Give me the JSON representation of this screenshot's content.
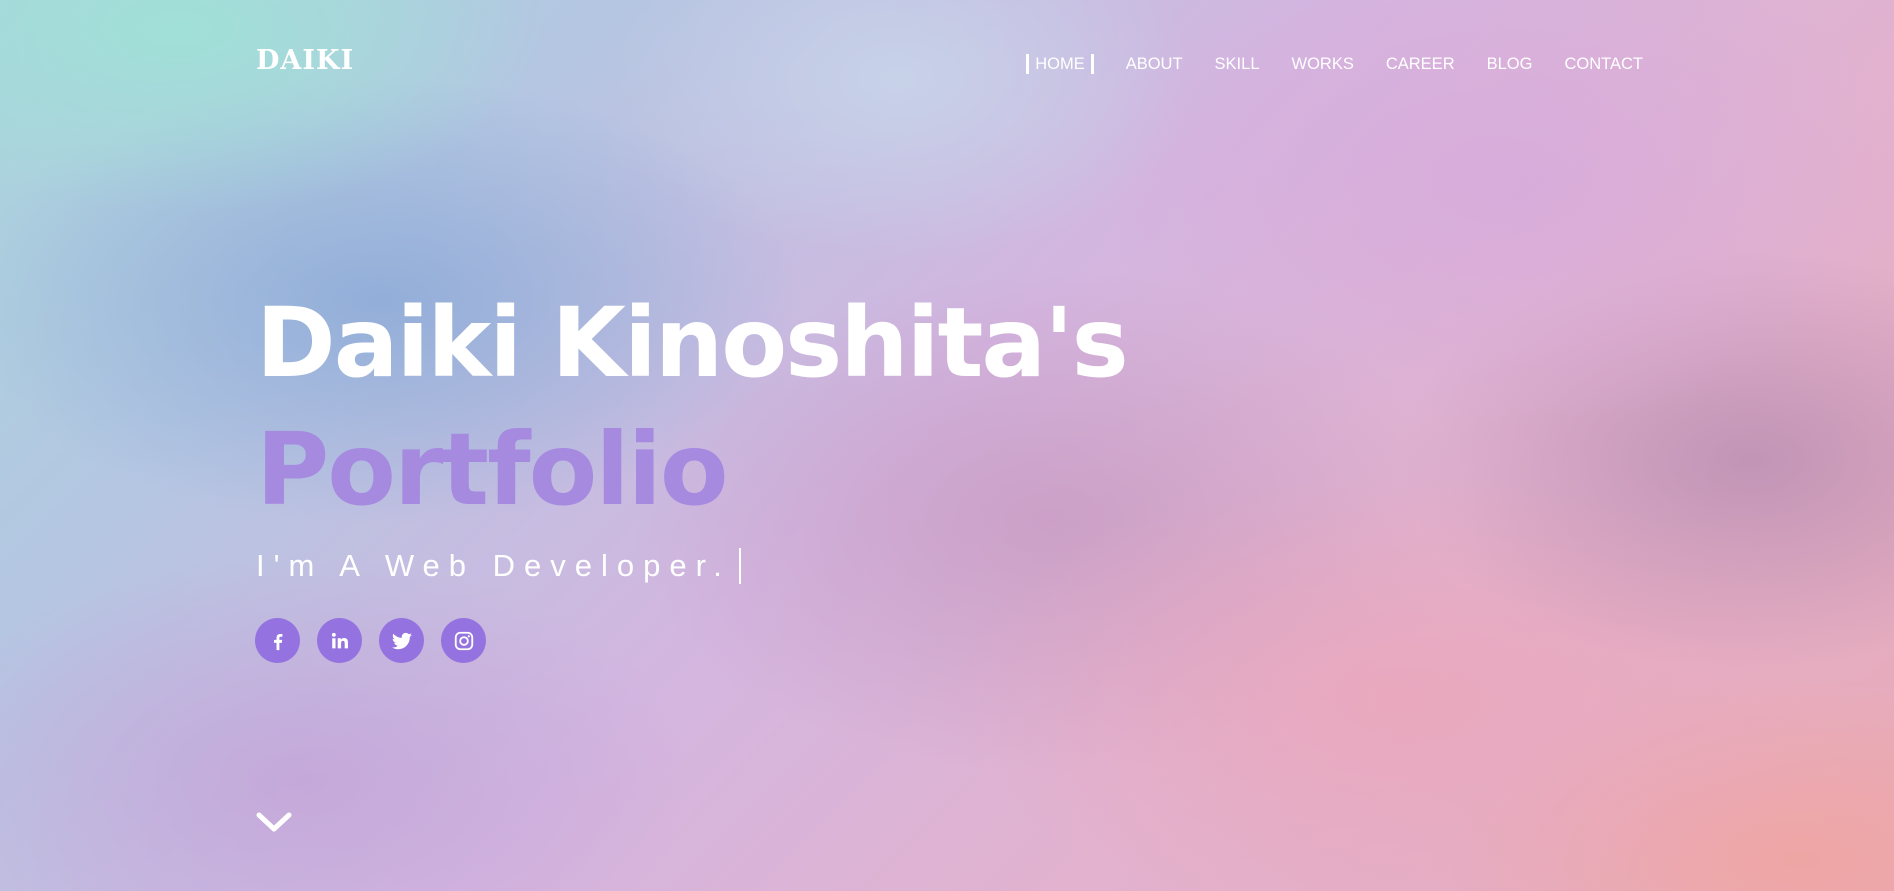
{
  "header": {
    "logo": "DAIKI",
    "nav": [
      {
        "label": "HOME",
        "active": true
      },
      {
        "label": "ABOUT",
        "active": false
      },
      {
        "label": "SKILL",
        "active": false
      },
      {
        "label": "WORKS",
        "active": false
      },
      {
        "label": "CAREER",
        "active": false
      },
      {
        "label": "BLOG",
        "active": false
      },
      {
        "label": "CONTACT",
        "active": false
      }
    ]
  },
  "hero": {
    "title_line1": "Daiki Kinoshita's",
    "title_line2": "Portfolio",
    "subtitle": "I'm A Web Developer.",
    "accent_color": "#a58ae0",
    "social_color": "#9472e0",
    "socials": [
      {
        "icon": "facebook-icon"
      },
      {
        "icon": "linkedin-icon"
      },
      {
        "icon": "twitter-icon"
      },
      {
        "icon": "instagram-icon"
      }
    ],
    "scroll_icon": "chevron-down-icon"
  }
}
